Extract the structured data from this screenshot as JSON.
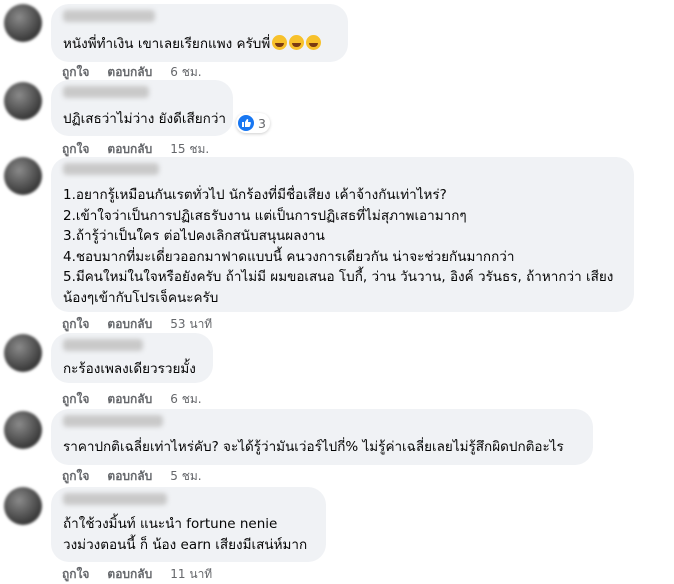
{
  "actions": {
    "like_label": "ถูกใจ",
    "reply_label": "ตอบกลับ"
  },
  "comments": [
    {
      "lines": [
        "หนังพี่ทำเงิน เขาเลยเรียกแพง ครับพี่"
      ],
      "emoji_count": 3,
      "time": "6 ชม."
    },
    {
      "lines": [
        "ปฏิเสธว่าไม่ว่าง ยังดีเสียกว่า"
      ],
      "reaction_count": "3",
      "time": "15 ชม."
    },
    {
      "lines": [
        "1.อยากรู้เหมือนกันเรตทั่วไป นักร้องที่มีชื่อเสียง เค้าจ้างกันเท่าไหร่?",
        "2.เข้าใจว่าเป็นการปฏิเสธรับงาน แต่เป็นการปฏิเสธที่ไม่สุภาพเอามากๆ",
        "3.ถ้ารู้ว่าเป็นใคร ต่อไปคงเลิกสนับสนุนผลงาน",
        "4.ชอบมากที่มะเดี่ยวออกมาฟาดแบบนี้ คนวงการเดียวกัน น่าจะช่วยกันมากกว่า",
        "5.มีคนใหม่ในใจหรือยังครับ ถ้าไม่มี ผมขอเสนอ โบกี้, ว่าน วันวาน, อิงค์ วรันธร, ถ้าหากว่า เสียง",
        "น้องๆเข้ากับโปรเจ็คนะครับ"
      ],
      "time": "53 นาที"
    },
    {
      "lines": [
        "กะร้องเพลงเดียวรวยมั้ง"
      ],
      "time": "6 ชม."
    },
    {
      "lines": [
        "ราคาปกติเฉลี่ยเท่าไหร่คับ? จะได้รู้ว่ามันเว่อร์ไปกี่% ไม่รู้ค่าเฉลี่ยเลยไม่รู้สึกผิดปกติอะไร"
      ],
      "time": "5 ชม."
    },
    {
      "lines": [
        "ถ้าใช้วงมิ้นท์ แนะนำ fortune nenie",
        "วงม่วงตอนนี้ ก็ น้อง earn เสียงมีเสน่ห์มาก"
      ],
      "time": "11 นาที"
    }
  ]
}
